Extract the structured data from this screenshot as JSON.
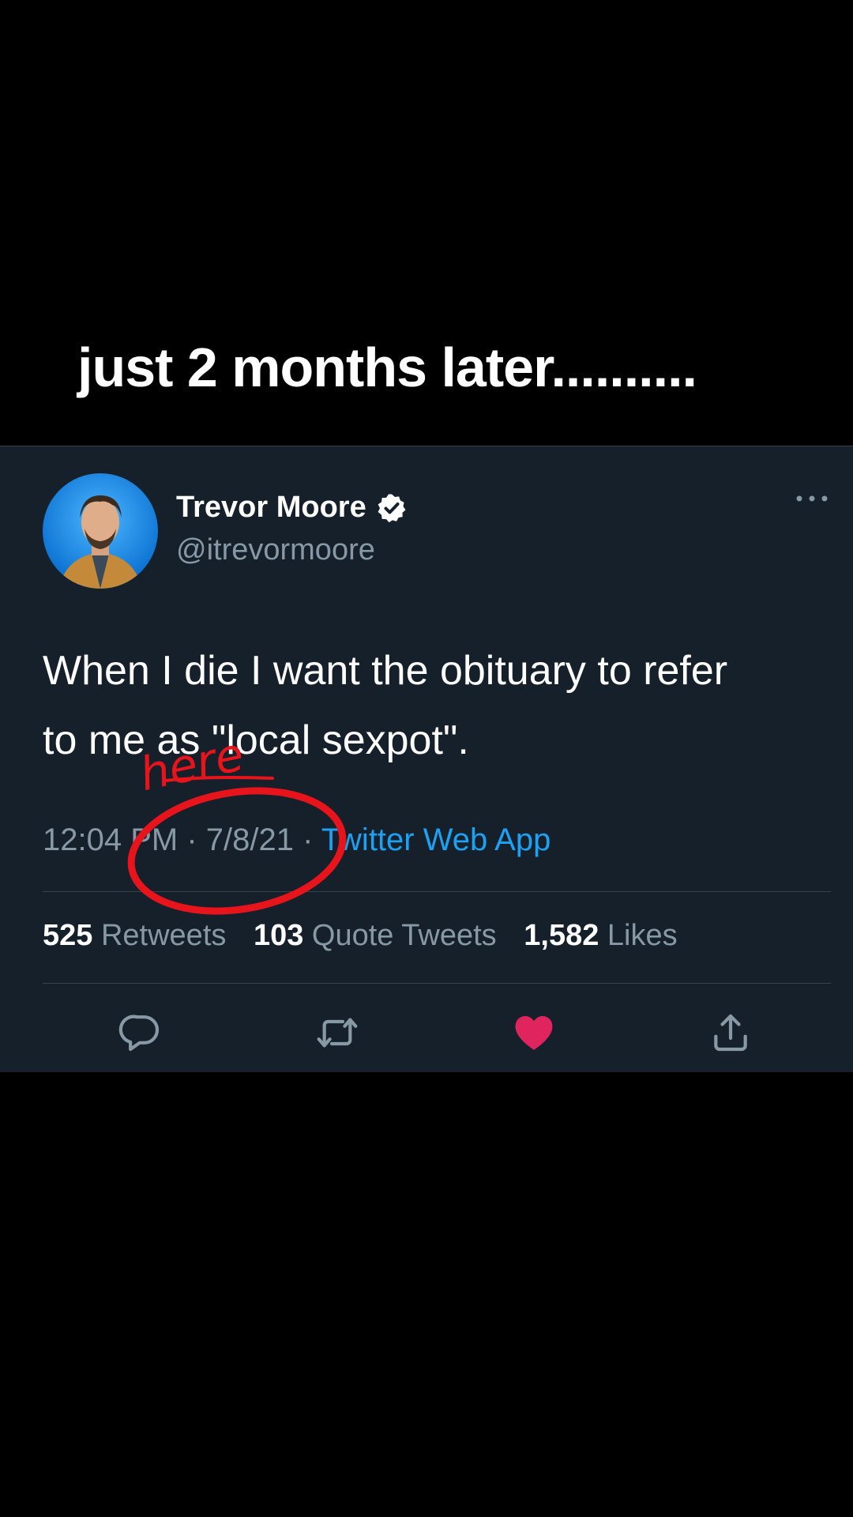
{
  "caption": "just 2 months later..........",
  "tweet": {
    "author_name": "Trevor Moore",
    "author_handle": "@itrevormoore",
    "text_line1": "When I die I want the obituary to refer",
    "text_line2": "to me as \"local sexpot\".",
    "time": "12:04 PM",
    "date": "7/8/21",
    "separator": " · ",
    "source": "Twitter Web App",
    "stats": {
      "retweets_count": "525",
      "retweets_label": "Retweets",
      "quotes_count": "103",
      "quotes_label": "Quote Tweets",
      "likes_count": "1,582",
      "likes_label": "Likes"
    },
    "liked": true
  },
  "annotation": {
    "handwritten_text": "here",
    "color": "#e8141c"
  },
  "colors": {
    "card_bg": "#15202b",
    "secondary_text": "#8899a6",
    "link": "#1da1f2",
    "like": "#e0245e"
  },
  "icons": [
    "verified-icon",
    "more-icon",
    "reply-icon",
    "retweet-icon",
    "like-icon",
    "share-icon"
  ]
}
